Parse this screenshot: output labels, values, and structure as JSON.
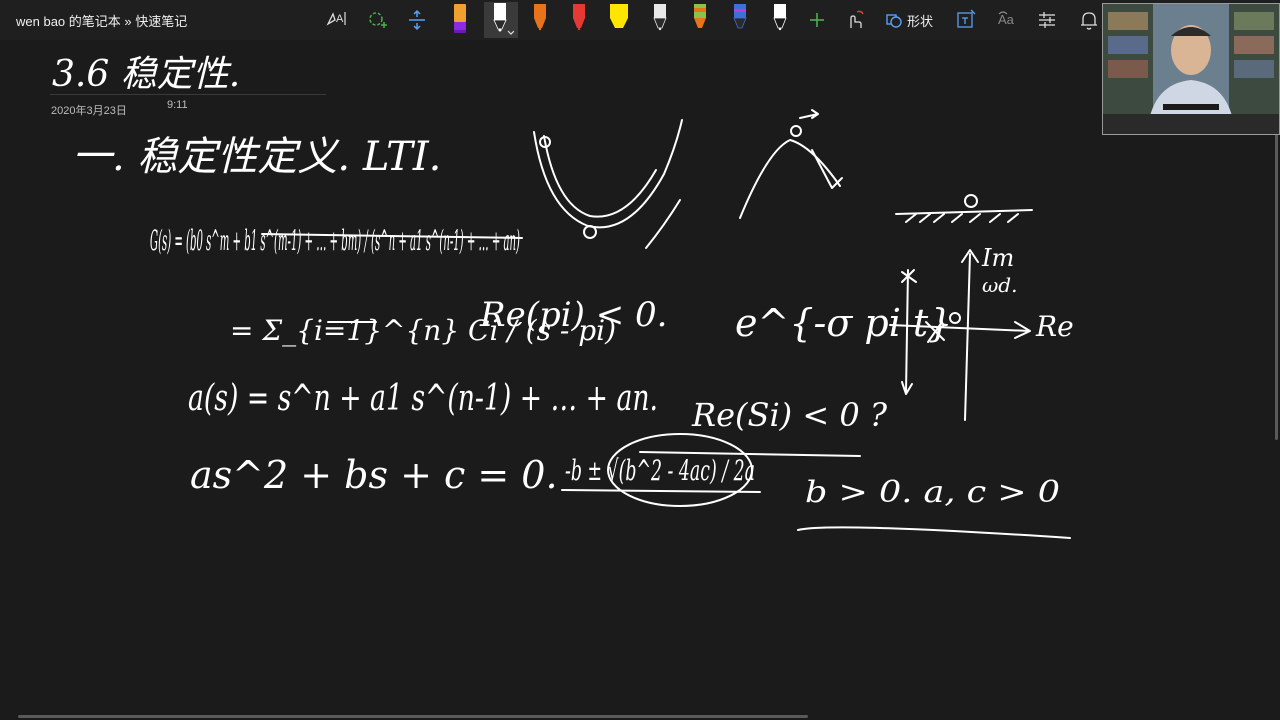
{
  "window": {
    "title": "wen bao 的笔记本 » 快速笔记"
  },
  "toolbar": {
    "tools": [
      {
        "name": "lasso-select-tool",
        "icon": "lasso-text-icon"
      },
      {
        "name": "lasso-tool",
        "icon": "lasso-plus-icon"
      },
      {
        "name": "insert-space-tool",
        "icon": "insert-space-icon"
      },
      {
        "name": "highlighter-purple",
        "icon": "pen-icon",
        "color": "#8a2be2"
      },
      {
        "name": "pen-white-selected",
        "icon": "pen-icon",
        "color": "#ffffff"
      },
      {
        "name": "pen-orange",
        "icon": "pen-icon",
        "color": "#e8731a"
      },
      {
        "name": "pen-red",
        "icon": "pen-icon",
        "color": "#e53935"
      },
      {
        "name": "highlighter-yellow",
        "icon": "highlighter-icon",
        "color": "#ffe600"
      },
      {
        "name": "pen-white-2",
        "icon": "pen-icon",
        "color": "#e8e8e8"
      },
      {
        "name": "pen-galaxy",
        "icon": "pen-icon",
        "color": "#8bc34a"
      },
      {
        "name": "pen-blue",
        "icon": "pen-icon",
        "color": "#3f6fd8"
      },
      {
        "name": "pen-white-3",
        "icon": "pen-icon",
        "color": "#ffffff"
      }
    ],
    "add_pen_icon": "plus-icon",
    "touch_draw_icon": "touch-draw-icon",
    "shape_label": "形状",
    "ink_to_shape_icon": "ink-to-shape-icon",
    "ink_to_text_icon": "ink-to-text-icon",
    "ink_replay_icon": "ink-replay-icon",
    "notifications_icon": "bell-icon"
  },
  "page": {
    "date": "2020年3月23日",
    "time": "9:11"
  },
  "ink": {
    "page_title": "3.6 稳定性.",
    "line1": "一. 稳定性定义. LTI.",
    "transfer_function": "G(s) = (b0 s^m + b1 s^(m-1) + … + bm) / (s^n + a1 s^(n-1) + … + an)",
    "partial_fraction": "= Σ_{i=1}^{n} Ci / (s - pi)",
    "re_condition": "Re(pi) < 0.",
    "exponential": "e^{-σ pi t}",
    "char_poly": "a(s) = s^n + a1 s^(n-1) + … + an.",
    "re_si": "Re(Si) < 0 ?",
    "quadratic": "as^2 + bs + c = 0.",
    "roots": "-b ± √(b^2 - 4ac) / 2a",
    "cond": "b > 0.   a, c > 0",
    "axis_im": "Im",
    "axis_wd": "ωd.",
    "axis_re": "Re"
  },
  "colors": {
    "background": "#1b1b1b",
    "toolbar": "#1f1f1f",
    "ink": "#ffffff"
  }
}
